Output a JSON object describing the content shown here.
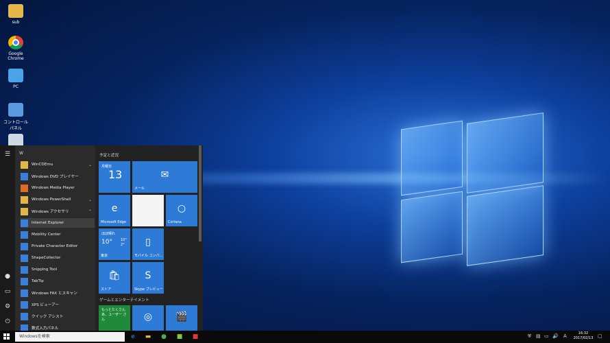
{
  "desktop": {
    "icons": [
      {
        "label": "sub",
        "icon": "folder-icon"
      },
      {
        "label": "Google Chrome",
        "icon": "chrome-icon"
      },
      {
        "label": "PC",
        "icon": "pc-icon"
      },
      {
        "label": "コントロール パネル",
        "icon": "control-panel-icon"
      },
      {
        "label": "",
        "icon": "recycle-bin-icon"
      }
    ]
  },
  "start_menu": {
    "letter": "W",
    "apps": [
      {
        "label": "WinCDEmu",
        "icon": "folder-icon",
        "expandable": true
      },
      {
        "label": "Windows DVD プレイヤー",
        "icon": "dvd-icon"
      },
      {
        "label": "Windows Media Player",
        "icon": "media-player-icon"
      },
      {
        "label": "Windows PowerShell",
        "icon": "folder-icon",
        "expandable": true
      },
      {
        "label": "Windows アクセサリ",
        "icon": "folder-icon",
        "expanded": true
      },
      {
        "label": "Internet Explorer",
        "icon": "ie-icon",
        "selected": true
      },
      {
        "label": "Mobility Center",
        "icon": "mobility-icon"
      },
      {
        "label": "Private Character Editor",
        "icon": "char-editor-icon"
      },
      {
        "label": "ShapeCollector",
        "icon": "shape-icon"
      },
      {
        "label": "Snipping Tool",
        "icon": "scissors-icon"
      },
      {
        "label": "TabTip",
        "icon": "keyboard-icon"
      },
      {
        "label": "Windows FAX とスキャン",
        "icon": "fax-icon"
      },
      {
        "label": "XPS ビューアー",
        "icon": "xps-icon"
      },
      {
        "label": "クイック アシスト",
        "icon": "assist-icon"
      },
      {
        "label": "数式入力パネル",
        "icon": "math-icon"
      }
    ],
    "tile_groups": [
      {
        "label": "予定と近況"
      },
      {
        "label": "ゲームとエンターテイメント"
      }
    ],
    "tiles": {
      "calendar_day": "月曜日",
      "calendar_date": "13",
      "mail": "メール",
      "edge": "Microsoft Edge",
      "cortana": "Cortana",
      "weather_desc": "ほぼ晴れ",
      "weather_temp": "10°",
      "weather_hi": "10°",
      "weather_lo": "2°",
      "weather_city": "東京",
      "mobile": "モバイル コンパ...",
      "store": "ストア",
      "skype": "Skype プレビュー",
      "promo": "もっとたくさん あ、ユーザー さん"
    }
  },
  "taskbar": {
    "search_placeholder": "Windowsを検索",
    "time": "16:32",
    "date": "2017/02/13",
    "ime": "A"
  }
}
